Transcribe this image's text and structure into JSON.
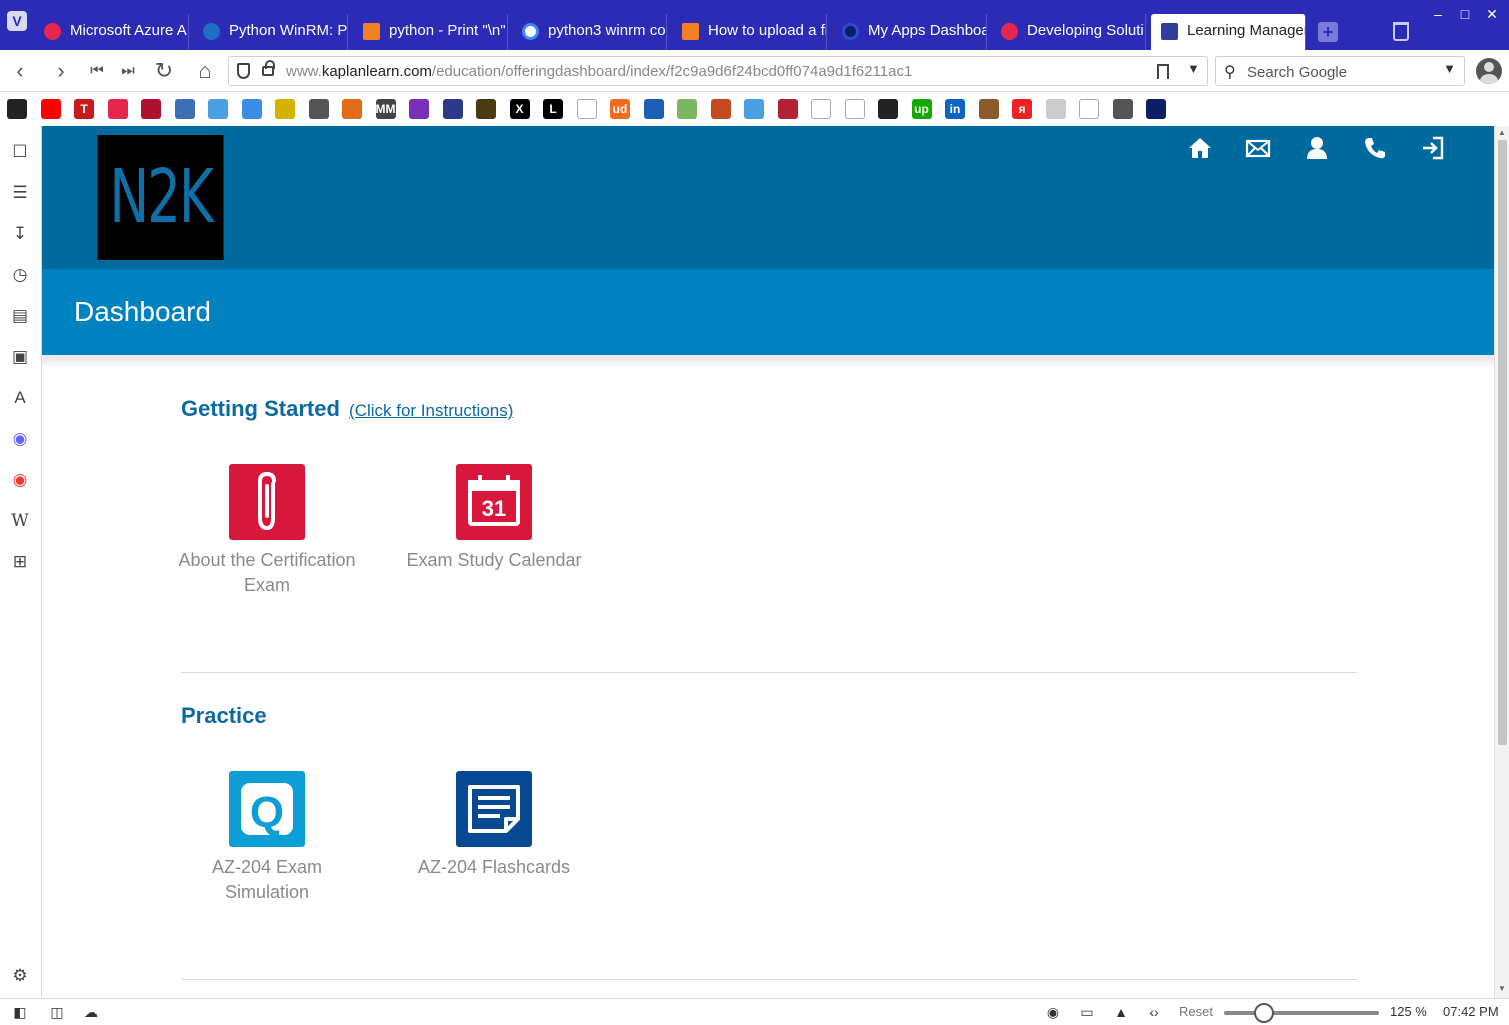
{
  "browser": {
    "tabs": [
      {
        "label": "Microsoft Azure A",
        "favicon": "vivaldi-red-icon"
      },
      {
        "label": "Python WinRM: Po",
        "favicon": "azure-icon"
      },
      {
        "label": "python - Print \"\\n\"",
        "favicon": "stackoverflow-icon"
      },
      {
        "label": "python3 winrm co",
        "favicon": "google-icon"
      },
      {
        "label": "How to upload a fi",
        "favicon": "stackoverflow-icon"
      },
      {
        "label": "My Apps Dashboa",
        "favicon": "okta-icon"
      },
      {
        "label": "Developing Soluti",
        "favicon": "vivaldi-red-icon"
      },
      {
        "label": "Learning Manager",
        "favicon": "book-icon",
        "active": true
      }
    ],
    "url": {
      "prefix": "www.",
      "domain": "kaplanlearn.com",
      "path": "/education/offeringdashboard/index/f2c9a9d6f24bcd0ff074a9d1f6211ac1"
    },
    "search_placeholder": "Search Google",
    "zoom": {
      "reset_label": "Reset",
      "value": "125 %",
      "level_percent": 125
    },
    "clock": "07:42 PM",
    "bookmark_icons": [
      "github-icon",
      "youtube-icon",
      "t-icon",
      "play-icon",
      "red-square-icon",
      "gear-badge-icon",
      "molecule-icon",
      "bot-icon",
      "note-icon",
      "figure-icon",
      "fox-icon",
      "mm-icon",
      "mail-icon",
      "user-icon",
      "horseshoe-icon",
      "x-icon",
      "l-icon",
      "page-icon",
      "ud-icon",
      "sail-icon",
      "flower-icon",
      "helmet-icon",
      "molecule-icon",
      "flag-icon",
      "page-icon",
      "page-icon",
      "dark-square-icon",
      "up-icon",
      "linkedin-icon",
      "tools-icon",
      "y-icon",
      "cloud-icon",
      "page-icon",
      "wave-icon",
      "ring-icon"
    ],
    "colors": {
      "chrome": "#2b2bb6",
      "header": "#006a9e",
      "band": "#0082c0",
      "title": "#0b69a3"
    }
  },
  "site": {
    "logo_text": "N2K",
    "page_title": "Dashboard",
    "header_icons": [
      "home-icon",
      "mail-icon",
      "user-icon",
      "phone-icon",
      "logout-icon"
    ]
  },
  "sections": {
    "getting_started": {
      "title": "Getting Started",
      "link": "(Click for Instructions)",
      "tiles": [
        {
          "label": "About the Certification Exam",
          "icon": "paperclip-icon",
          "color": "#d7173b"
        },
        {
          "label": "Exam Study Calendar",
          "icon": "calendar-icon",
          "color": "#d7173b",
          "badge": "31"
        }
      ]
    },
    "practice": {
      "title": "Practice",
      "tiles": [
        {
          "label": "AZ-204 Exam Simulation",
          "icon": "quiz-icon",
          "color": "#0b9fd6",
          "badge": "Q"
        },
        {
          "label": "AZ-204 Flashcards",
          "icon": "flashcards-icon",
          "color": "#074a92"
        }
      ]
    }
  }
}
